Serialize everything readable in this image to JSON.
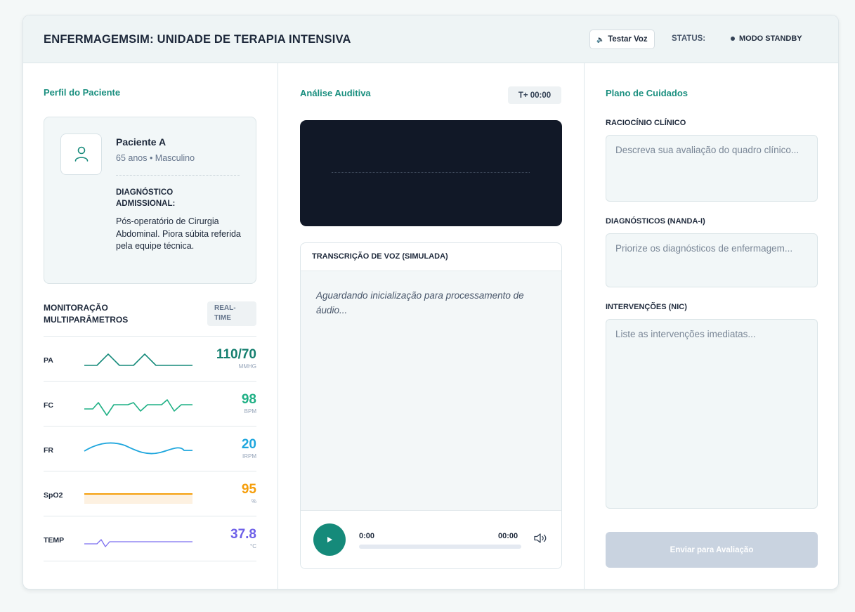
{
  "header": {
    "title": "ENFERMAGEMSIM: UNIDADE DE TERAPIA INTENSIVA",
    "voice_button": "Testar Voz",
    "status_label": "STATUS:",
    "status_value": "MODO STANDBY"
  },
  "patient": {
    "section_title": "Perfil do Paciente",
    "name": "Paciente A",
    "details": "65 anos • Masculino",
    "diagnosis_label": "DIAGNÓSTICO ADMISSIONAL:",
    "diagnosis_text": "Pós-operatório de Cirurgia Abdominal. Piora súbita referida pela equipe técnica."
  },
  "monitor": {
    "title": "MONITORAÇÃO MULTIPARÂMETROS",
    "badge": "REAL-TIME",
    "vitals": [
      {
        "label": "PA",
        "value": "110/70",
        "unit": "MMHG",
        "color": "#157f6f"
      },
      {
        "label": "FC",
        "value": "98",
        "unit": "BPM",
        "color": "#1fb085"
      },
      {
        "label": "FR",
        "value": "20",
        "unit": "IRPM",
        "color": "#1ea6dd"
      },
      {
        "label": "SpO2",
        "value": "95",
        "unit": "%",
        "color": "#f59e0b"
      },
      {
        "label": "TEMP",
        "value": "37.8",
        "unit": "°C",
        "color": "#6d5fe8"
      }
    ]
  },
  "audio": {
    "section_title": "Análise Auditiva",
    "timer": "T+ 00:00",
    "transcript_title": "TRANSCRIÇÃO DE VOZ (SIMULADA)",
    "transcript_text": "Aguardando inicialização para processamento de áudio...",
    "current_time": "0:00",
    "duration": "00:00",
    "progress": 0
  },
  "care_plan": {
    "section_title": "Plano de Cuidados",
    "reasoning_label": "RACIOCÍNIO CLÍNICO",
    "reasoning_placeholder": "Descreva sua avaliação do quadro clínico...",
    "diagnoses_label": "DIAGNÓSTICOS (NANDA-I)",
    "diagnoses_placeholder": "Priorize os diagnósticos de enfermagem...",
    "interventions_label": "INTERVENÇÕES (NIC)",
    "interventions_placeholder": "Liste as intervenções imediatas...",
    "submit_label": "Enviar para Avaliação"
  },
  "colors": {
    "accent": "#158a7a",
    "header_bg": "#eef4f5",
    "waveform_bg": "#111827",
    "submit_disabled": "#c9d3e0"
  },
  "icons": [
    "speaker-icon",
    "user-icon",
    "play-icon",
    "volume-icon"
  ]
}
